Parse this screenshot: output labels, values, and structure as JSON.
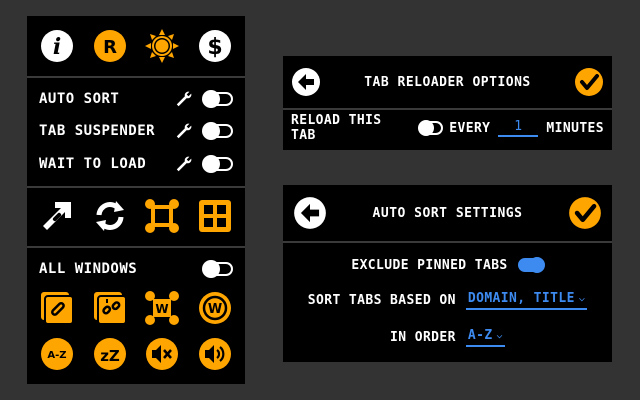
{
  "left_panel": {
    "top_icons": [
      "info-icon",
      "r-icon",
      "sun-icon",
      "dollar-icon"
    ],
    "top_glyphs": {
      "info": "i",
      "r": "R",
      "dollar": "$"
    },
    "options": [
      {
        "label": "AUTO SORT"
      },
      {
        "label": "TAB SUSPENDER"
      },
      {
        "label": "WAIT TO LOAD"
      }
    ],
    "action_icons": [
      "unpin-arrow-icon",
      "reload-icon",
      "crossed-tab-icon",
      "grid-icon"
    ],
    "all_windows_label": "ALL WINDOWS",
    "bottom_icons_row1": [
      "link-tab-icon",
      "unlink-tab-icon",
      "w-crossed-icon",
      "w-circle-icon"
    ],
    "bottom_icons_row2": [
      "a-z-icon",
      "sleep-icon",
      "mute-icon",
      "volume-icon"
    ],
    "glyphs": {
      "w": "W",
      "az": "A-Z",
      "zz": "zZ"
    }
  },
  "reloader": {
    "title": "TAB RELOADER OPTIONS",
    "reload_label": "RELOAD THIS TAB",
    "every_label": "EVERY",
    "every_value": "1",
    "minutes_label": "MINUTES"
  },
  "autosort": {
    "title": "AUTO SORT SETTINGS",
    "exclude_label": "EXCLUDE PINNED TABS",
    "sort_label": "SORT TABS BASED ON",
    "sort_value": "DOMAIN, TITLE",
    "order_label": "IN ORDER",
    "order_value": "A-Z"
  },
  "colors": {
    "accent": "#FFA500",
    "blue": "#3D8BF0",
    "panel": "#000000",
    "background": "#333333"
  }
}
